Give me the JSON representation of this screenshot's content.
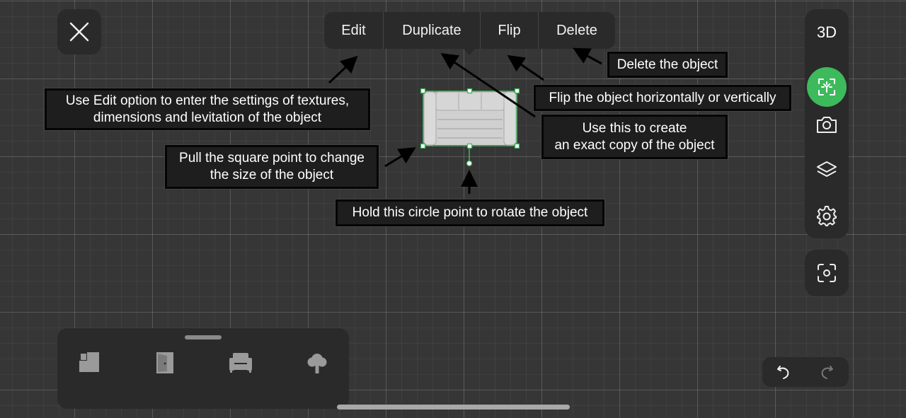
{
  "context_menu": {
    "items": [
      "Edit",
      "Duplicate",
      "Flip",
      "Delete"
    ]
  },
  "callouts": {
    "edit_line1": "Use Edit option to enter the settings of textures,",
    "edit_line2": "dimensions and levitation of the object",
    "delete": "Delete the object",
    "flip": "Flip the object horizontally or vertically",
    "duplicate_line1": "Use this to create",
    "duplicate_line2": "an exact copy of the object",
    "resize_line1": "Pull the square point to change",
    "resize_line2": "the size of the object",
    "rotate": "Hold this circle point to rotate the object"
  },
  "right_rail": {
    "view_toggle": "3D",
    "tools": [
      "select-tool-icon",
      "camera-icon",
      "layers-icon",
      "settings-gear-icon"
    ],
    "snapshot": "screenshot-icon"
  },
  "bottom_categories": [
    "rooms-icon",
    "door-icon",
    "armchair-icon",
    "tree-icon"
  ],
  "history": {
    "undo": "undo-icon",
    "redo": "redo-icon"
  },
  "colors": {
    "accent": "#3dba5c",
    "panel": "#2a2a2a",
    "background": "#363636"
  }
}
